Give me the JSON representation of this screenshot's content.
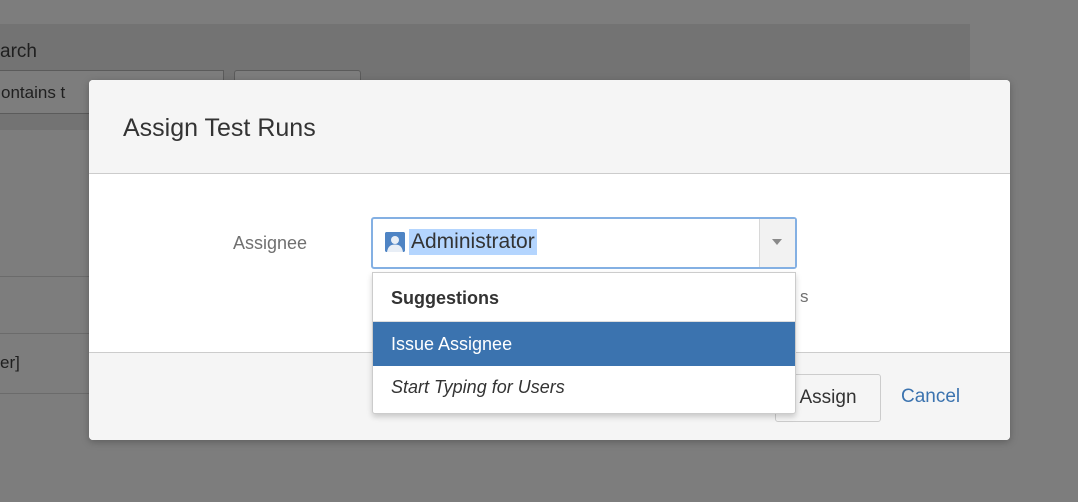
{
  "background": {
    "search_title": "arch",
    "search_input_text": "ontains t",
    "row_text": "er]"
  },
  "dialog": {
    "title": "Assign Test Runs",
    "assignee_label": "Assignee",
    "hint_fragment": "s",
    "assignee_select": {
      "value": "Administrator",
      "avatar_icon": "user-avatar-icon"
    },
    "dropdown": {
      "heading": "Suggestions",
      "items": [
        {
          "label": "Issue Assignee",
          "selected": true
        },
        {
          "label": "Start Typing for Users",
          "selected": false
        }
      ]
    },
    "footer": {
      "assign_label": "Assign",
      "cancel_label": "Cancel"
    }
  },
  "colors": {
    "accent": "#3b73af",
    "focus_border": "#84b0e3",
    "selection_highlight": "#b4d5fe",
    "overlay": "#7d7d7d"
  }
}
